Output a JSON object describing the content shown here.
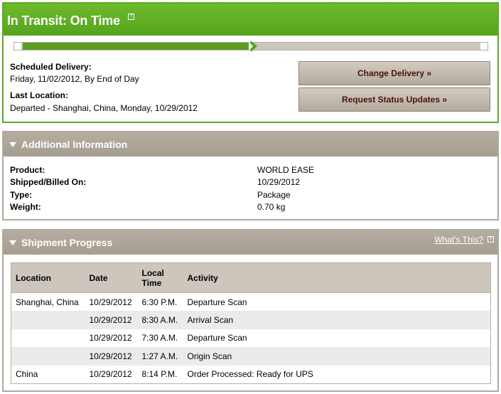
{
  "transit": {
    "title": "In Transit: On Time",
    "progress_fraction": 0.5,
    "scheduled_label": "Scheduled Delivery:",
    "scheduled_value": "Friday, 11/02/2012, By End of Day",
    "last_location_label": "Last Location:",
    "last_location_value": "Departed - Shanghai, China, Monday, 10/29/2012",
    "change_delivery": "Change Delivery »",
    "request_updates": "Request Status Updates »"
  },
  "additional": {
    "title": "Additional Information",
    "rows": [
      {
        "label": "Product:",
        "value": "WORLD EASE"
      },
      {
        "label": "Shipped/Billed On:",
        "value": "10/29/2012"
      },
      {
        "label": "Type:",
        "value": "Package"
      },
      {
        "label": "Weight:",
        "value": "0.70 kg"
      }
    ]
  },
  "shipment": {
    "title": "Shipment Progress",
    "whats_this": "What's This?",
    "columns": [
      "Location",
      "Date",
      "Local Time",
      "Activity"
    ],
    "rows": [
      {
        "location": "Shanghai, China",
        "date": "10/29/2012",
        "time": "6:30 P.M.",
        "activity": "Departure Scan"
      },
      {
        "location": "",
        "date": "10/29/2012",
        "time": "8:30 A.M.",
        "activity": "Arrival Scan"
      },
      {
        "location": "",
        "date": "10/29/2012",
        "time": "7:30 A.M.",
        "activity": "Departure Scan"
      },
      {
        "location": "",
        "date": "10/29/2012",
        "time": "1:27 A.M.",
        "activity": "Origin Scan"
      },
      {
        "location": "China",
        "date": "10/29/2012",
        "time": "8:14 P.M.",
        "activity": "Order Processed: Ready for UPS"
      }
    ]
  },
  "colors": {
    "brand_green": "#5ea823",
    "panel_tan": "#b2aa9c",
    "button_text": "#4a120c"
  },
  "icons": [
    "help-icon",
    "triangle-down-icon",
    "progress-arrow-icon"
  ]
}
